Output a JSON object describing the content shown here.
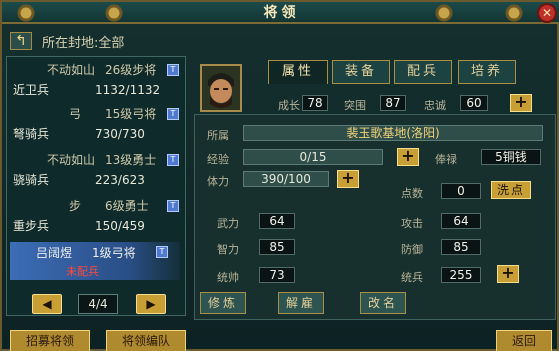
{
  "title": "将领",
  "location": "所在封地:全部",
  "generals_list": [
    {
      "skill": "不动如山",
      "level": "26级步将",
      "name": "近卫兵",
      "troops": "1132/1132"
    },
    {
      "skill": "弓",
      "level": "15级弓将",
      "name": "弩骑兵",
      "troops": "730/730"
    },
    {
      "skill": "不动如山",
      "level": "13级勇士",
      "name": "骁骑兵",
      "troops": "223/623"
    },
    {
      "skill": "步",
      "level": "6级勇士",
      "name": "重步兵",
      "troops": "150/459"
    }
  ],
  "selected_general": {
    "name": "吕阔煜",
    "level": "1级弓将",
    "status": "未配兵"
  },
  "pager": {
    "prev": "◀",
    "page": "4/4",
    "next": "▶"
  },
  "bottom_buttons": {
    "recruit": "招募将领",
    "formation": "将领编队",
    "back": "返回"
  },
  "tabs": [
    "属性",
    "装备",
    "配兵",
    "培养"
  ],
  "top_stats": {
    "growth_label": "成长",
    "growth": "78",
    "breakthrough_label": "突围",
    "breakthrough": "87",
    "loyalty_label": "忠诚",
    "loyalty": "60"
  },
  "detail": {
    "belong_label": "所属",
    "belong": "裴玉歌基地(洛阳)",
    "exp_label": "经验",
    "exp": "0/15",
    "salary_label": "俸禄",
    "salary": "5铜钱",
    "stamina_label": "体力",
    "stamina": "390/100",
    "points_label": "点数",
    "points": "0",
    "wash_label": "洗点",
    "attrs": [
      {
        "label": "武力",
        "value": "64"
      },
      {
        "label": "智力",
        "value": "85"
      },
      {
        "label": "统帅",
        "value": "73"
      }
    ],
    "combat": [
      {
        "label": "攻击",
        "value": "64"
      },
      {
        "label": "防御",
        "value": "85"
      },
      {
        "label": "统兵",
        "value": "255"
      }
    ],
    "actions": [
      "修炼",
      "解雇",
      "改名"
    ]
  },
  "icons": {
    "plus": "+",
    "badge": "T",
    "back": "↰",
    "close": "✕"
  }
}
